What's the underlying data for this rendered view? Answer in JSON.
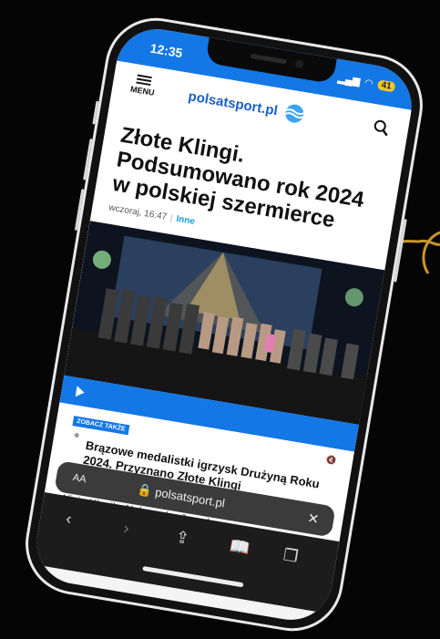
{
  "status_bar": {
    "time": "12:35",
    "battery": "41"
  },
  "header": {
    "menu_label": "MENU",
    "logo_text": "polsatsport.pl",
    "search_icon": "search-icon"
  },
  "article": {
    "title": "Złote Klingi. Podsumowano rok 2024 w polskiej szermierce",
    "date": "wczoraj, 16:47",
    "category": "Inne"
  },
  "related": {
    "badge": "ZOBACZ TAKŻE",
    "title": "Brązowe medalistki igrzysk Drużyną Roku 2024. Przyznano Złote Klingi",
    "excerpt": "Brązowe medalistki olimpijskie z Paryża szpadzistki Alicja Klasik, Aleksandra Jarecka"
  },
  "browser": {
    "text_size": "AA",
    "url": "polsatsport.pl",
    "icons": [
      "back-icon",
      "forward-icon",
      "share-icon",
      "bookmarks-icon",
      "tabs-icon"
    ]
  },
  "colors": {
    "brand_blue": "#1477e6",
    "accent_gold": "#c9962b",
    "background": "#050505"
  }
}
